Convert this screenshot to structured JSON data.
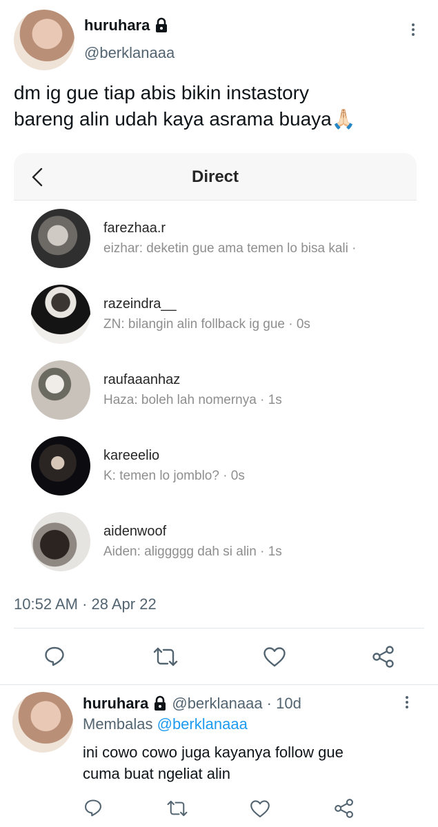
{
  "tweet": {
    "display_name": "huruhara",
    "handle": "@berklanaaa",
    "text_line1": "dm ig gue tiap abis bikin instastory",
    "text_line2": "bareng alin udah kaya asrama buaya",
    "emoji": "🙏🏻",
    "timestamp": "10:52 AM · 28 Apr 22"
  },
  "dm_card": {
    "title": "Direct",
    "threads": [
      {
        "username": "farezhaa.r",
        "preview": "eizhar: deketin gue ama temen lo bisa kali ·"
      },
      {
        "username": "razeindra__",
        "preview": "ZN: bilangin alin follback ig gue · 0s"
      },
      {
        "username": "raufaaanhaz",
        "preview": "Haza: boleh lah nomernya · 1s"
      },
      {
        "username": "kareeelio",
        "preview": "K: temen lo jomblo? · 0s"
      },
      {
        "username": "aidenwoof",
        "preview": "Aiden: aliggggg dah si alin · 1s"
      }
    ]
  },
  "reply": {
    "display_name": "huruhara",
    "handle_time": "@berklanaaa · 10d",
    "replying_prefix": "Membalas",
    "replying_to": "@berklanaaa",
    "text_line1": "ini cowo cowo juga kayanya follow gue",
    "text_line2": "cuma buat ngeliat alin"
  },
  "colors": {
    "accent": "#1d9bf0",
    "secondary_text": "#536471",
    "dm_preview": "#8e8e8e"
  },
  "icons": [
    "lock-icon",
    "more-icon",
    "back-chevron-icon",
    "reply-icon",
    "retweet-icon",
    "like-icon",
    "share-icon"
  ]
}
